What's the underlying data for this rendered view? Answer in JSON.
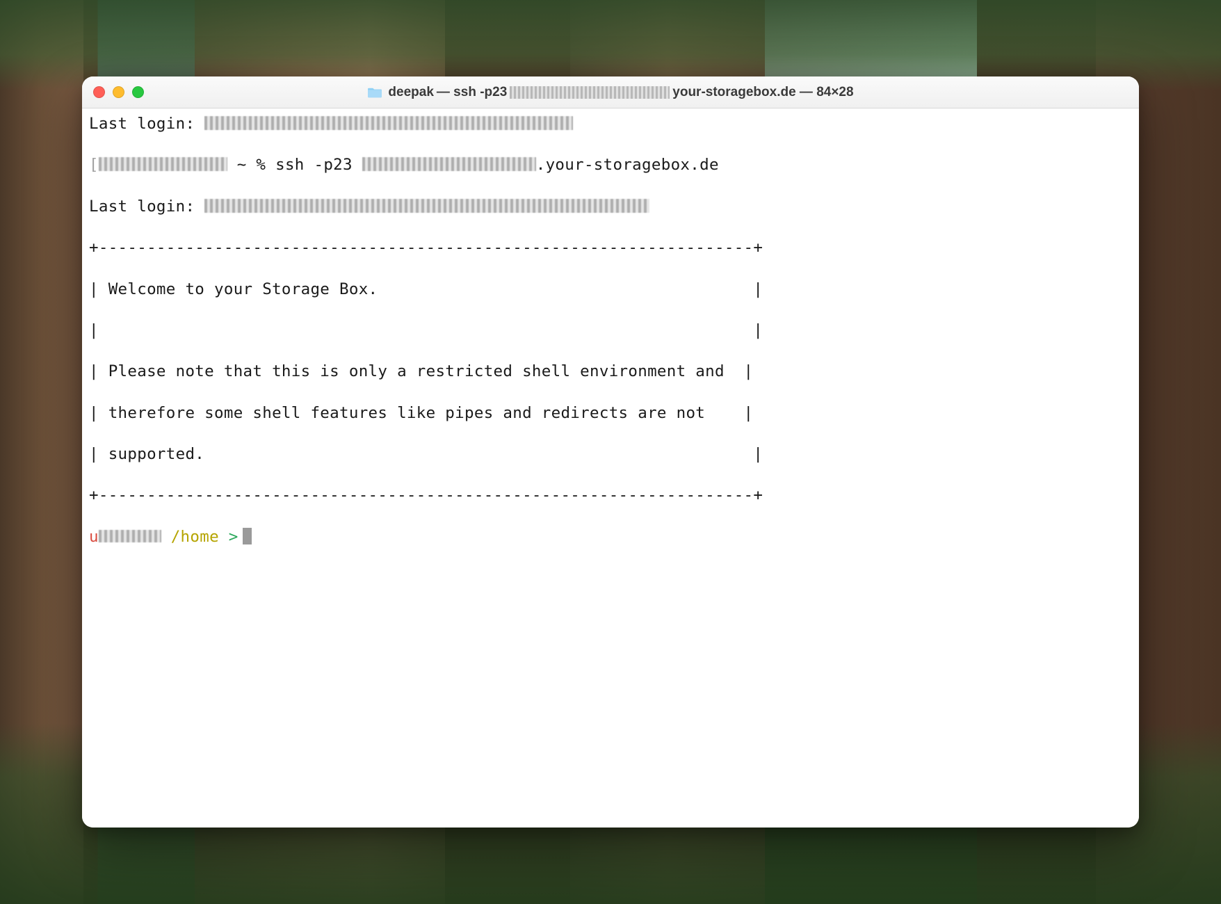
{
  "window": {
    "title_folder": "deepak",
    "title_cmd_prefix": " — ssh -p23 ",
    "title_cmd_suffix": "your-storagebox.de — 84×28"
  },
  "terminal": {
    "last_login1_label": "Last login: ",
    "shell_prompt_tilde": " ~ % ",
    "ssh_cmd_prefix": "ssh -p23 ",
    "ssh_cmd_suffix": ".your-storagebox.de",
    "last_login2_label": "Last login: ",
    "box_top": "+--------------------------------------------------------------------+",
    "box_line1": "| Welcome to your Storage Box.                                       |",
    "box_blank": "|                                                                    |",
    "box_line2": "| Please note that this is only a restricted shell environment and  |",
    "box_line3": "| therefore some shell features like pipes and redirects are not    |",
    "box_line4": "| supported.                                                         |",
    "box_bottom": "+--------------------------------------------------------------------+",
    "prompt": {
      "user_prefix": "u",
      "path": " /home ",
      "gt": ">"
    }
  }
}
